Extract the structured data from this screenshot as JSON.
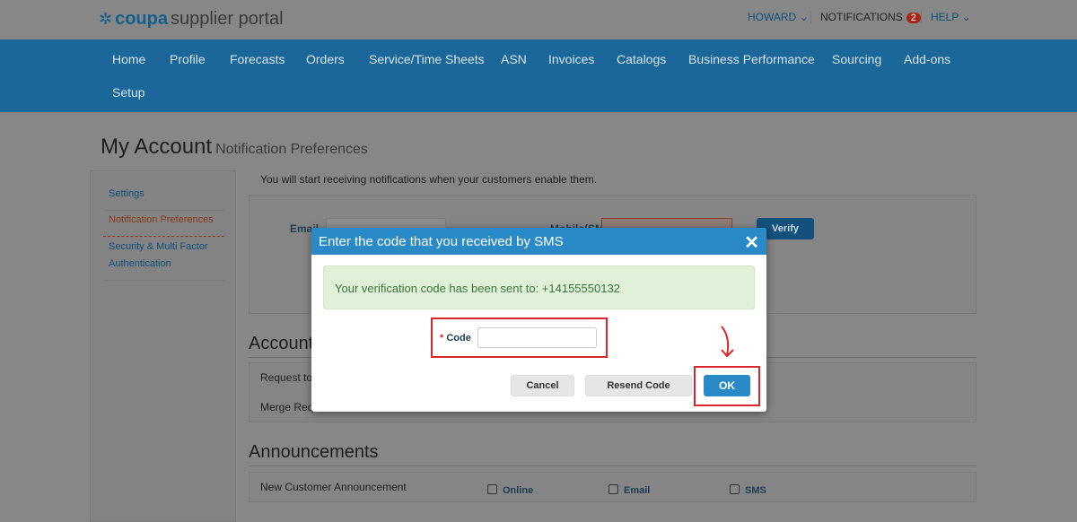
{
  "header": {
    "logo_brand": "coupa",
    "logo_suffix": "supplier portal",
    "user": "HOWARD",
    "notifications": "NOTIFICATIONS",
    "notif_count": "2",
    "help": "HELP"
  },
  "nav": [
    "Home",
    "Profile",
    "Forecasts",
    "Orders",
    "Service/Time Sheets",
    "ASN",
    "Invoices",
    "Catalogs",
    "Business Performance",
    "Sourcing",
    "Add-ons",
    "Setup"
  ],
  "page": {
    "title": "My Account",
    "subtitle": "Notification Preferences",
    "info": "You will start receiving notifications when your customers enable them."
  },
  "sidebar": [
    "Settings",
    "Notification Preferences",
    "Security & Multi Factor Authentication"
  ],
  "contact": {
    "email_label": "Email",
    "mobile_label": "Mobile(SMS)",
    "verify": "Verify"
  },
  "sections": {
    "account": "Account",
    "account_rows": [
      "Request to",
      "Merge Req"
    ],
    "announcements": "Announcements",
    "ann_row": "New Customer Announcement",
    "options": [
      "Online",
      "Email",
      "SMS"
    ]
  },
  "modal": {
    "title": "Enter the code that you received by SMS",
    "message": "Your verification code has been sent to: +14155550132",
    "code_label": "Code",
    "code_value": "",
    "cancel": "Cancel",
    "resend": "Resend Code",
    "ok": "OK"
  },
  "colors": {
    "accent": "#2a8ac8",
    "highlight": "#d9262b"
  }
}
